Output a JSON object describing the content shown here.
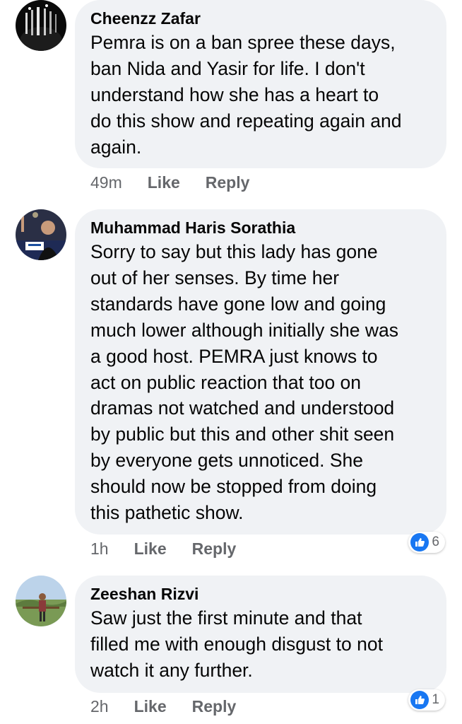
{
  "colors": {
    "bubble_bg": "#f0f2f5",
    "text": "#050505",
    "meta": "#65676b",
    "like_blue": "#1877f2"
  },
  "comments": [
    {
      "author": "Cheenzz Zafar",
      "text": "Pemra is on a ban spree these days,\nban Nida and Yasir for life. I don't\nunderstand how she has a heart to\ndo this show and repeating again and\nagain.",
      "time": "49m",
      "like_label": "Like",
      "reply_label": "Reply"
    },
    {
      "author": "Muhammad Haris Sorathia",
      "text": "Sorry to say but this lady has gone\nout of her senses. By time her\nstandards have gone low and going\nmuch lower although initially she was\na good host. PEMRA just knows to\nact on public reaction that too on\ndramas not watched and understood\nby public but this and other shit seen\nby everyone gets unnoticed. She\nshould now be stopped from doing\nthis pathetic show.",
      "time": "1h",
      "like_label": "Like",
      "reply_label": "Reply",
      "reaction_icon": "thumbs-up-icon",
      "reaction_count": "6"
    },
    {
      "author": "Zeeshan Rizvi",
      "text": "Saw just the first minute and that\nfilled me with enough disgust to not\nwatch it any further.",
      "time": "2h",
      "like_label": "Like",
      "reply_label": "Reply",
      "reaction_icon": "thumbs-up-icon",
      "reaction_count": "1"
    }
  ]
}
